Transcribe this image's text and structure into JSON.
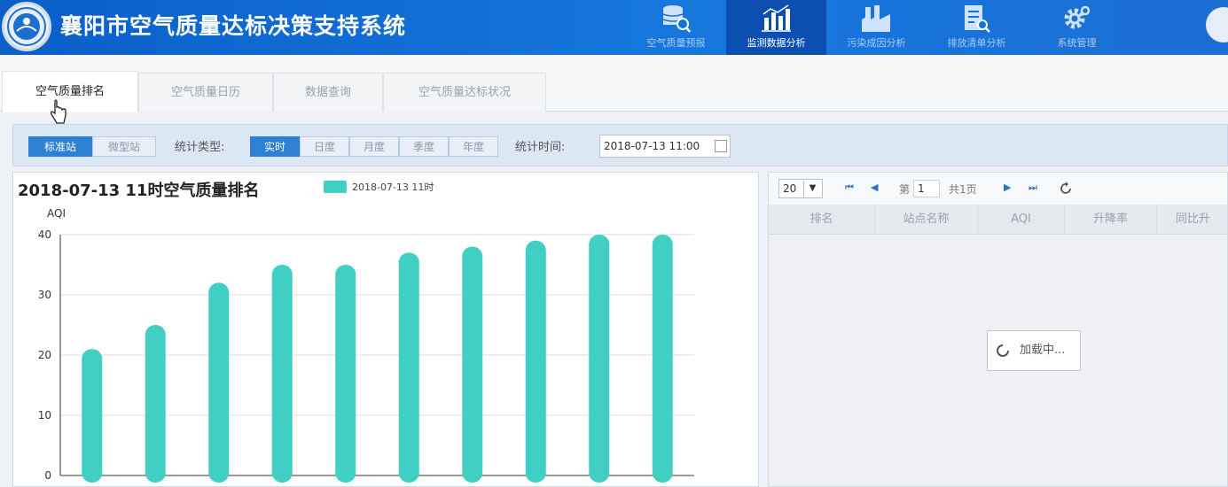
{
  "app": {
    "title": "襄阳市空气质量达标决策支持系统"
  },
  "nav": [
    {
      "label": "空气质量预报",
      "icon": "database-search-icon",
      "active": false
    },
    {
      "label": "监测数据分析",
      "icon": "bar-chart-icon",
      "active": true
    },
    {
      "label": "污染成因分析",
      "icon": "factory-icon",
      "active": false
    },
    {
      "label": "排放清单分析",
      "icon": "document-search-icon",
      "active": false
    },
    {
      "label": "系统管理",
      "icon": "gear-icon",
      "active": false
    }
  ],
  "tabs": [
    {
      "label": "空气质量排名",
      "active": true
    },
    {
      "label": "空气质量日历",
      "active": false
    },
    {
      "label": "数据查询",
      "active": false
    },
    {
      "label": "空气质量达标状况",
      "active": false
    }
  ],
  "filters": {
    "station_types": [
      {
        "label": "标准站",
        "active": true
      },
      {
        "label": "微型站",
        "active": false
      }
    ],
    "stat_type_label": "统计类型:",
    "stat_types": [
      {
        "label": "实时",
        "active": true
      },
      {
        "label": "日度",
        "active": false
      },
      {
        "label": "月度",
        "active": false
      },
      {
        "label": "季度",
        "active": false
      },
      {
        "label": "年度",
        "active": false
      }
    ],
    "stat_time_label": "统计时间:",
    "stat_time_value": "2018-07-13 11:00"
  },
  "colors": {
    "bar": "#41cfc4",
    "header": "#1570d8",
    "active_button": "#2e80d4"
  },
  "chart_data": {
    "type": "bar",
    "title": "2018-07-13 11时空气质量排名",
    "ylabel": "AQI",
    "ylim": [
      0,
      40
    ],
    "yticks": [
      0,
      10,
      20,
      30,
      40
    ],
    "series": [
      {
        "name": "2018-07-13 11时",
        "values": [
          21,
          25,
          32,
          35,
          35,
          37,
          38,
          39,
          40,
          40
        ]
      }
    ]
  },
  "table": {
    "page_size": "20",
    "page_label_prefix": "第",
    "page_number": "1",
    "total_pages_label": "共1页",
    "columns": [
      "排名",
      "站点名称",
      "AQI",
      "升降率",
      "同比升"
    ],
    "loading_text": "加载中..."
  }
}
